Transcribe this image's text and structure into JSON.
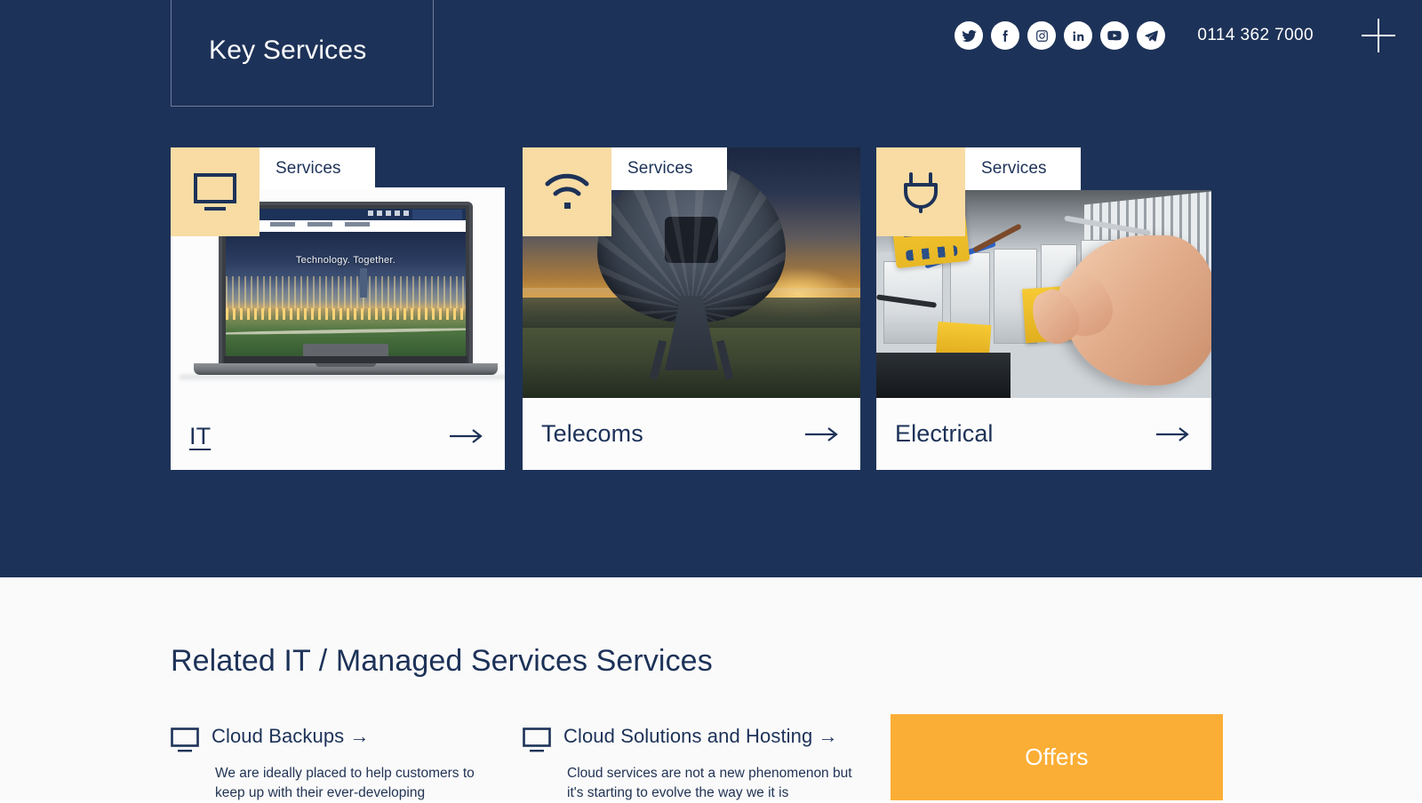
{
  "page": {
    "title": "Key Services",
    "navy": "#1D3258",
    "sand": "#F8DCA4",
    "orange": "#FBAE35"
  },
  "header": {
    "phone": "0114 362 7000",
    "menu_toggle": "plus-icon",
    "social": [
      {
        "name": "twitter",
        "label": "Twitter"
      },
      {
        "name": "facebook",
        "label": "Facebook"
      },
      {
        "name": "instagram",
        "label": "Instagram"
      },
      {
        "name": "linkedin",
        "label": "LinkedIn"
      },
      {
        "name": "youtube",
        "label": "YouTube"
      },
      {
        "name": "telegram",
        "label": "Share"
      }
    ]
  },
  "cards": [
    {
      "badge": "Services",
      "icon": "monitor-icon",
      "title": "IT",
      "arrow": "→",
      "hovered": true,
      "image_alt": "Laptop showing a website with a city skyline",
      "laptop_tagline": "Technology. Together."
    },
    {
      "badge": "Services",
      "icon": "wifi-icon",
      "title": "Telecoms",
      "arrow": "→",
      "hovered": false,
      "image_alt": "Satellite dish at sunset"
    },
    {
      "badge": "Services",
      "icon": "plug-icon",
      "title": "Electrical",
      "arrow": "→",
      "hovered": false,
      "image_alt": "Hands wiring an electrical distribution board"
    }
  ],
  "related": {
    "heading": "Related IT / Managed Services Services",
    "items": [
      {
        "icon": "monitor-icon",
        "title": "Cloud Backups",
        "arrow": "→",
        "description": "We are ideally placed to help customers to keep up with their ever-developing"
      },
      {
        "icon": "monitor-icon",
        "title": "Cloud Solutions and Hosting",
        "arrow": "→",
        "description": "Cloud services are not a new phenomenon but it's starting to evolve the way we it is"
      }
    ],
    "offers_label": "Offers"
  }
}
